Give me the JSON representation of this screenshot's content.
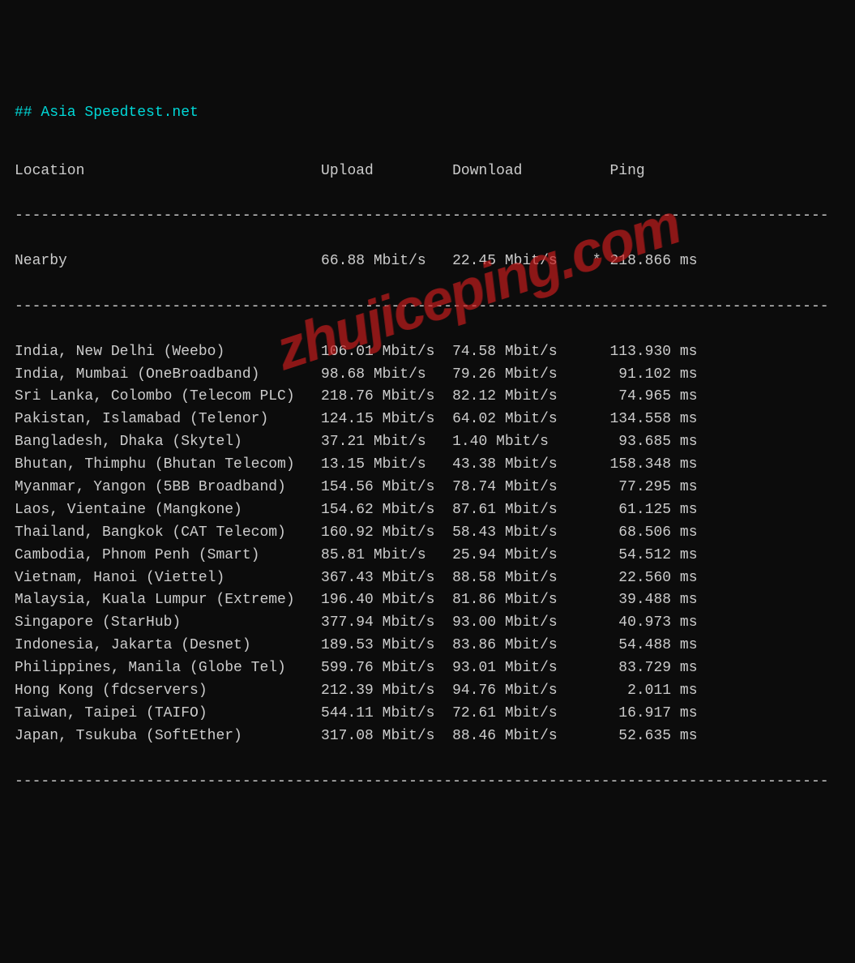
{
  "title": "## Asia Speedtest.net",
  "headers": {
    "location": "Location",
    "upload": "Upload",
    "download": "Download",
    "ping": "Ping"
  },
  "divider": "---------------------------------------------------------------------------------------------",
  "nearby": {
    "location": "Nearby",
    "upload": "66.88 Mbit/s",
    "download": "22.45 Mbit/s",
    "ping": "* 218.866 ms"
  },
  "rows": [
    {
      "location": "India, New Delhi (Weebo)",
      "upload": "106.01 Mbit/s",
      "download": "74.58 Mbit/s",
      "ping": "113.930 ms"
    },
    {
      "location": "India, Mumbai (OneBroadband)",
      "upload": "98.68 Mbit/s",
      "download": "79.26 Mbit/s",
      "ping": "91.102 ms"
    },
    {
      "location": "Sri Lanka, Colombo (Telecom PLC)",
      "upload": "218.76 Mbit/s",
      "download": "82.12 Mbit/s",
      "ping": "74.965 ms"
    },
    {
      "location": "Pakistan, Islamabad (Telenor)",
      "upload": "124.15 Mbit/s",
      "download": "64.02 Mbit/s",
      "ping": "134.558 ms"
    },
    {
      "location": "Bangladesh, Dhaka (Skytel)",
      "upload": "37.21 Mbit/s",
      "download": "1.40 Mbit/s",
      "ping": "93.685 ms"
    },
    {
      "location": "Bhutan, Thimphu (Bhutan Telecom)",
      "upload": "13.15 Mbit/s",
      "download": "43.38 Mbit/s",
      "ping": "158.348 ms"
    },
    {
      "location": "Myanmar, Yangon (5BB Broadband)",
      "upload": "154.56 Mbit/s",
      "download": "78.74 Mbit/s",
      "ping": "77.295 ms"
    },
    {
      "location": "Laos, Vientaine (Mangkone)",
      "upload": "154.62 Mbit/s",
      "download": "87.61 Mbit/s",
      "ping": "61.125 ms"
    },
    {
      "location": "Thailand, Bangkok (CAT Telecom)",
      "upload": "160.92 Mbit/s",
      "download": "58.43 Mbit/s",
      "ping": "68.506 ms"
    },
    {
      "location": "Cambodia, Phnom Penh (Smart)",
      "upload": "85.81 Mbit/s",
      "download": "25.94 Mbit/s",
      "ping": "54.512 ms"
    },
    {
      "location": "Vietnam, Hanoi (Viettel)",
      "upload": "367.43 Mbit/s",
      "download": "88.58 Mbit/s",
      "ping": "22.560 ms"
    },
    {
      "location": "Malaysia, Kuala Lumpur (Extreme)",
      "upload": "196.40 Mbit/s",
      "download": "81.86 Mbit/s",
      "ping": "39.488 ms"
    },
    {
      "location": "Singapore (StarHub)",
      "upload": "377.94 Mbit/s",
      "download": "93.00 Mbit/s",
      "ping": "40.973 ms"
    },
    {
      "location": "Indonesia, Jakarta (Desnet)",
      "upload": "189.53 Mbit/s",
      "download": "83.86 Mbit/s",
      "ping": "54.488 ms"
    },
    {
      "location": "Philippines, Manila (Globe Tel)",
      "upload": "599.76 Mbit/s",
      "download": "93.01 Mbit/s",
      "ping": "83.729 ms"
    },
    {
      "location": "Hong Kong (fdcservers)",
      "upload": "212.39 Mbit/s",
      "download": "94.76 Mbit/s",
      "ping": "2.011 ms"
    },
    {
      "location": "Taiwan, Taipei (TAIFO)",
      "upload": "544.11 Mbit/s",
      "download": "72.61 Mbit/s",
      "ping": "16.917 ms"
    },
    {
      "location": "Japan, Tsukuba (SoftEther)",
      "upload": "317.08 Mbit/s",
      "download": "88.46 Mbit/s",
      "ping": "52.635 ms"
    }
  ],
  "watermark": "zhujiceping.com"
}
